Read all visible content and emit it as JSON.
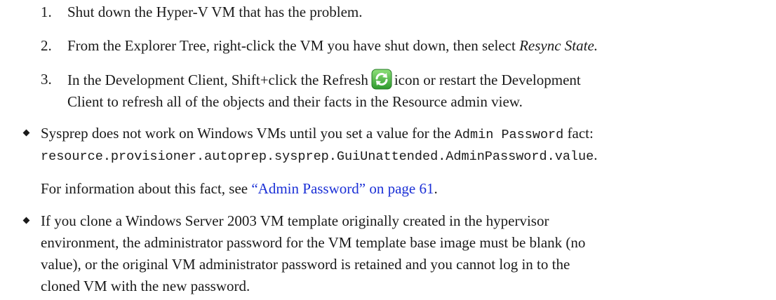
{
  "steps": [
    {
      "num": "1.",
      "text": "Shut down the Hyper-V VM that has the problem."
    },
    {
      "num": "2.",
      "text": "From the Explorer Tree, right-click the VM you have shut down, then select ",
      "italic": "Resync State."
    },
    {
      "num": "3.",
      "text_before_icon": "In the Development Client, Shift+click the Refresh",
      "text_after_icon": "icon or restart the Development",
      "line2": "Client to refresh all of the objects and their facts in the Resource admin view."
    }
  ],
  "refresh_icon": {
    "name": "refresh-icon",
    "color": "#3aa63a"
  },
  "bullets": [
    {
      "line1_before": "Sysprep does not work on Windows VMs until you set a value for the ",
      "line1_code": "Admin Password",
      "line1_after": " fact:",
      "line2_code": "resource.provisioner.autoprep.sysprep.GuiUnattended.AdminPassword.value",
      "line2_after": ".",
      "para2_before": "For information about this fact, see ",
      "para2_link": "“Admin Password” on page 61",
      "para2_after": "."
    },
    {
      "lines": [
        "If you clone a Windows Server 2003 VM template originally created in the hypervisor",
        "environment, the administrator password for the VM template base image must be blank (no",
        "value), or the original VM administrator password is retained and you cannot log in to the",
        "cloned VM with the new password."
      ]
    }
  ],
  "colors": {
    "text": "#1a1a1a",
    "link": "#1a2fd6"
  }
}
